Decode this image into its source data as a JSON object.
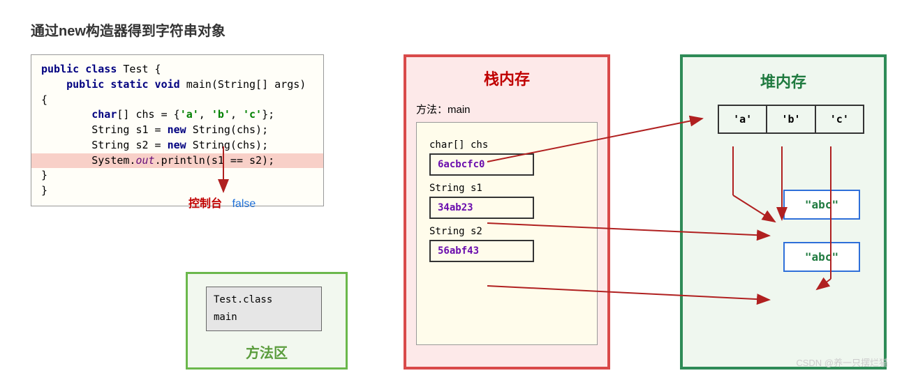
{
  "title": "通过new构造器得到字符串对象",
  "code": {
    "l1_kw1": "public class",
    "l1_name": " Test {",
    "l2_kw1": "public static void",
    "l2_rest": " main(String[] args) {",
    "l3_kw": "char",
    "l3_mid": "[] chs = {",
    "l3_a": "'a'",
    "l3_c1": ", ",
    "l3_b": "'b'",
    "l3_c2": ", ",
    "l3_c": "'c'",
    "l3_end": "};",
    "l4_a": "String s1 = ",
    "l4_kw": "new",
    "l4_b": " String(chs);",
    "l5_a": "String s2 = ",
    "l5_kw": "new",
    "l5_b": " String(chs);",
    "l6_a": "System.",
    "l6_fld": "out",
    "l6_b": ".println(s1 == s2);",
    "l7": "    }",
    "l8": "}"
  },
  "console": {
    "label": "控制台",
    "value": "false"
  },
  "method_area": {
    "title": "方法区",
    "class_name": "Test.class",
    "method": "main"
  },
  "stack": {
    "title": "栈内存",
    "method_label": "方法：main",
    "vars": [
      {
        "label": "char[] chs",
        "addr": "6acbcfc0"
      },
      {
        "label": "String s1",
        "addr": "34ab23"
      },
      {
        "label": "String s2",
        "addr": "56abf43"
      }
    ]
  },
  "heap": {
    "title": "堆内存",
    "chars": [
      "'a'",
      "'b'",
      "'c'"
    ],
    "str1": "\"abc\"",
    "str2": "\"abc\""
  },
  "watermark": "CSDN @养一只摆烂猫"
}
